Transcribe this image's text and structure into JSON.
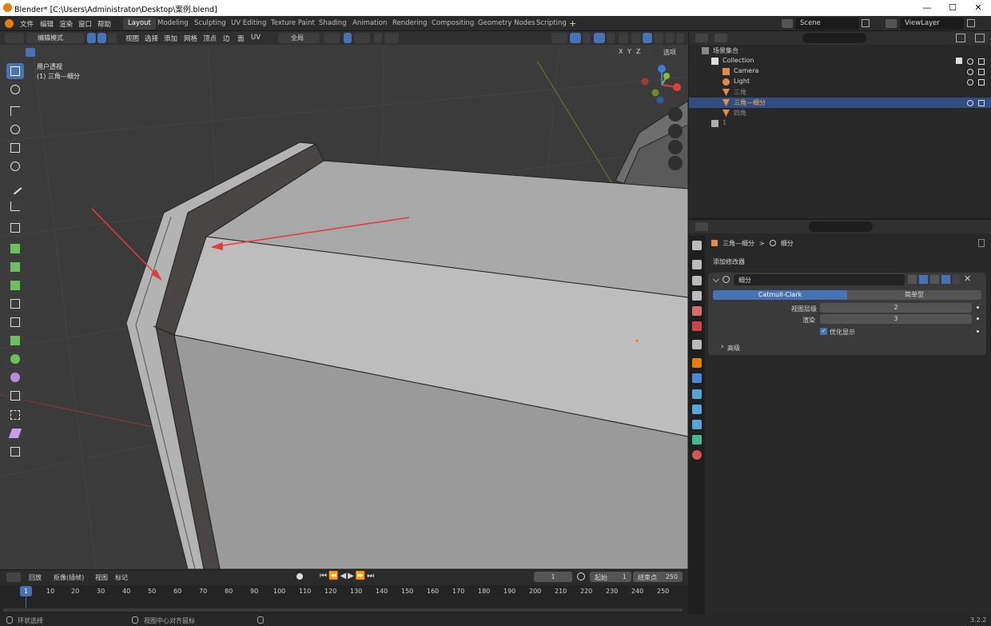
{
  "window": {
    "title": "Blender* [C:\\Users\\Administrator\\Desktop\\案例.blend]",
    "min_glyph": "—",
    "max_glyph": "☐",
    "close_glyph": "✕"
  },
  "menu": [
    "文件",
    "编辑",
    "渲染",
    "窗口",
    "帮助"
  ],
  "workspaces": [
    "Layout",
    "Modeling",
    "Sculpting",
    "UV Editing",
    "Texture Paint",
    "Shading",
    "Animation",
    "Rendering",
    "Compositing",
    "Geometry Nodes",
    "Scripting"
  ],
  "workspace_add": "+",
  "scene": {
    "name": "Scene",
    "view_layer": "ViewLayer"
  },
  "viewport_header": {
    "mode": "编辑模式",
    "menus": [
      "视图",
      "选择",
      "添加",
      "网格",
      "顶点",
      "边",
      "面",
      "UV"
    ],
    "transform_orientation": "全局",
    "axis_x": "X",
    "axis_y": "Y",
    "axis_z": "Z",
    "options": "选项"
  },
  "viewport": {
    "view_name": "用户透视",
    "object_name": "(1) 三角—细分"
  },
  "outliner": {
    "root": "场景集合",
    "items": [
      {
        "name": "Collection",
        "icon": "collection-icon"
      },
      {
        "name": "Camera",
        "icon": "camera-icon"
      },
      {
        "name": "Light",
        "icon": "light-icon"
      },
      {
        "name": "三角",
        "icon": "mesh-icon"
      },
      {
        "name": "三角—细分",
        "icon": "mesh-icon",
        "selected": true
      },
      {
        "name": "四角",
        "icon": "mesh-icon"
      },
      {
        "name": "1",
        "icon": "collection-icon"
      }
    ]
  },
  "properties": {
    "breadcrumb_object": "三角—细分",
    "breadcrumb_sep": ">",
    "breadcrumb_modifier": "细分",
    "add_modifier": "添加修改器",
    "modifier_name": "细分",
    "mode_catmull": "Catmull-Clark",
    "mode_simple": "简单型",
    "viewport_levels_label": "视图层级",
    "viewport_levels_value": "2",
    "render_label": "渲染",
    "render_value": "3",
    "optimal_display": "优化显示",
    "advanced": "高级"
  },
  "timeline": {
    "menus": [
      "回放",
      "抠像(插帧)",
      "视图",
      "标记"
    ],
    "current_frame": "1",
    "start_label": "起始",
    "start_value": "1",
    "end_label": "结束点",
    "end_value": "250",
    "ticks": [
      "1",
      "10",
      "20",
      "30",
      "40",
      "50",
      "60",
      "70",
      "80",
      "90",
      "100",
      "110",
      "120",
      "130",
      "140",
      "150",
      "160",
      "170",
      "180",
      "190",
      "200",
      "210",
      "220",
      "230",
      "240",
      "250"
    ]
  },
  "status": {
    "left": "环状选择",
    "middle": "视图中心对齐鼠标",
    "version": "3.2.2"
  },
  "colors": {
    "accent": "#4772b3",
    "selected_row": "#334d80",
    "arrow": "#e23c3c",
    "orange": "#e87d0d"
  }
}
